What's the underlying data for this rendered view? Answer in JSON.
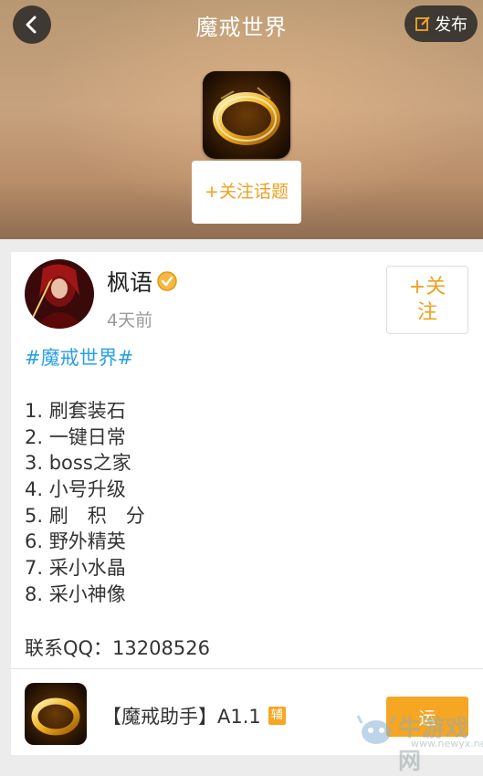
{
  "header": {
    "title": "魔戒世界",
    "publish_label": "发布",
    "follow_topic_label": "+关注话题"
  },
  "post": {
    "author": "枫语",
    "time": "4天前",
    "follow_label": "+关注",
    "hashtag": "#魔戒世界#",
    "items": [
      "1. 刷套装石",
      "2. 一键日常",
      "3. boss之家",
      "4. 小号升级",
      "5. 刷　积　分",
      "6. 野外精英",
      "7. 采小水晶",
      "8. 采小神像"
    ],
    "contact": "联系QQ：13208526"
  },
  "app": {
    "name": "【魔戒助手】A1.1",
    "tag": "辅",
    "run_label": "运"
  },
  "watermark": {
    "cn": "牛游戏网",
    "url": "www.newyx.net"
  },
  "icons": {
    "back": "chevron-left-icon",
    "publish": "edit-icon",
    "verified": "verified-badge-icon"
  },
  "colors": {
    "accent": "#f0a020",
    "hashtag": "#2aa0e8",
    "run_button": "#f5a623"
  }
}
